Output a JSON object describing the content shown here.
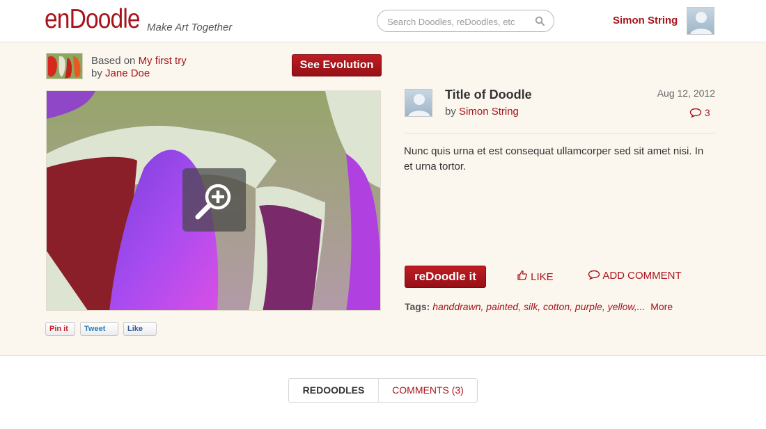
{
  "header": {
    "logo": "enDoodle",
    "tagline": "Make Art Together",
    "search_placeholder": "Search Doodles, reDoodles, etc",
    "user_name": "Simon String"
  },
  "based_on": {
    "prefix": "Based on",
    "title": "My first try",
    "by_prefix": "by",
    "author": "Jane Doe"
  },
  "see_evolution_label": "See Evolution",
  "share": {
    "pin_label": "Pin it",
    "tweet_label": "Tweet",
    "like_label": "Like"
  },
  "doodle": {
    "title": "Title of Doodle",
    "by_prefix": "by",
    "author": "Simon String",
    "date": "Aug 12, 2012",
    "comment_count": "3",
    "description": "Nunc quis urna et est consequat ullamcorper sed sit amet nisi. In et urna tortor."
  },
  "actions": {
    "redoodle_label": "reDoodle it",
    "like_label": "LIKE",
    "add_comment_label": "ADD COMMENT"
  },
  "tags": {
    "label": "Tags:",
    "items": [
      "handdrawn,",
      "painted,",
      "silk,",
      "cotton,",
      "purple,",
      "yellow,..."
    ],
    "more_label": "More"
  },
  "tabs": {
    "redoodles": "REDOODLES",
    "comments": "COMMENTS (3)"
  },
  "colors": {
    "brand": "#a8141c",
    "background": "#fbf6ee"
  }
}
